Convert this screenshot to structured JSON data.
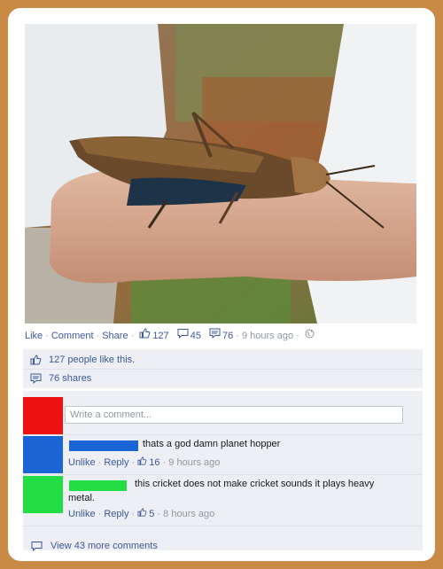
{
  "post": {
    "photo_alt": "photo",
    "actions": {
      "like": "Like",
      "comment": "Comment",
      "share": "Share",
      "like_count": "127",
      "comment_count": "45",
      "share_count": "76",
      "time": "9 hours ago"
    },
    "likes_text": "127 people like this.",
    "shares_text": "76 shares",
    "comment_placeholder": "Write a comment...",
    "comments": [
      {
        "avatar_color": "#ee1111",
        "namebar_color": "#1a64d6",
        "text": "thats a god damn planet hopper",
        "unlike": "Unlike",
        "reply": "Reply",
        "likes": "16",
        "time": "9 hours ago",
        "avatar_color_2": "#1a64d6"
      },
      {
        "avatar_color": "#22dd44",
        "namebar_color": "#22dd44",
        "text_line1": "this cricket does not make cricket sounds it plays heavy",
        "text_line2": "metal.",
        "unlike": "Unlike",
        "reply": "Reply",
        "likes": "5",
        "time": "8 hours ago"
      }
    ],
    "view_more": "View 43 more comments"
  },
  "colors": {
    "frame": "#c98a45",
    "link": "#3b5998",
    "box_bg": "#edeff4",
    "red_avatar": "#ee1111",
    "blue_avatar": "#1a64d6",
    "green_avatar": "#22dd44"
  }
}
